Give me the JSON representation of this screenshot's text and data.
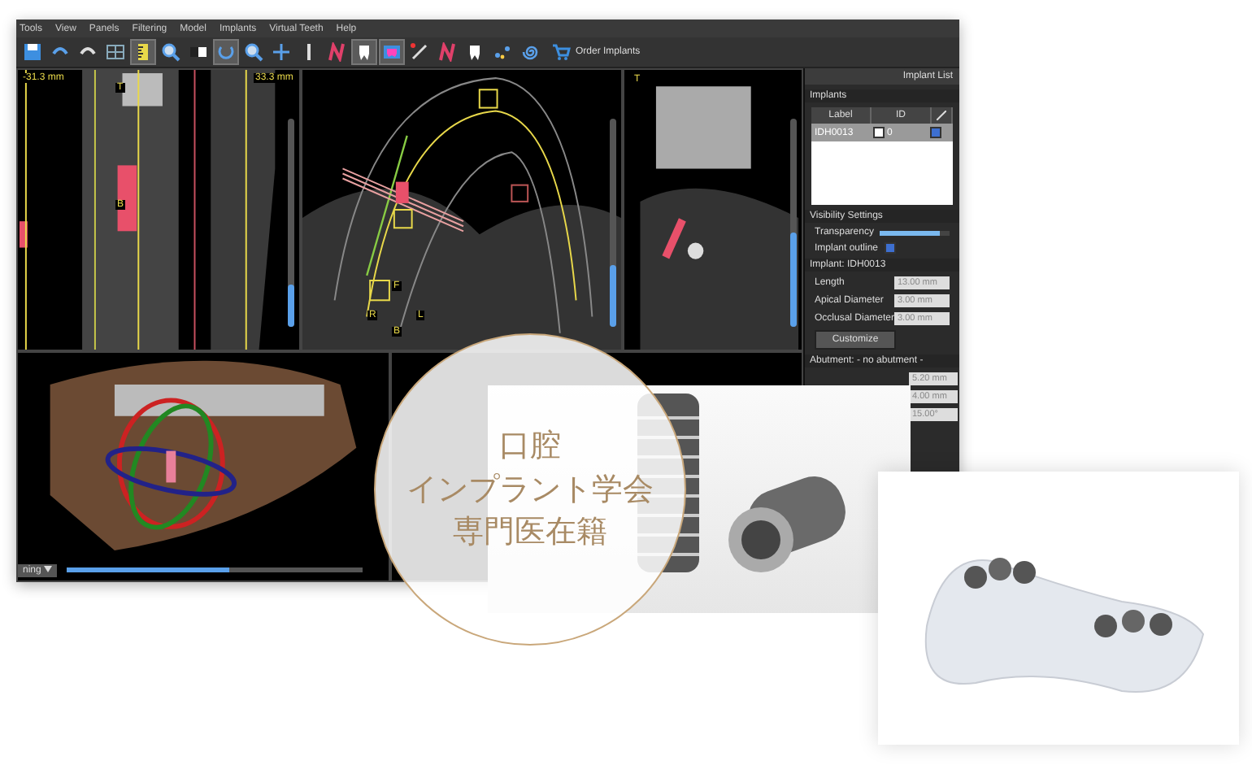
{
  "menu": [
    "Tools",
    "View",
    "Panels",
    "Filtering",
    "Model",
    "Implants",
    "Virtual Teeth",
    "Help"
  ],
  "toolbar": [
    {
      "kind": "save",
      "selected": false
    },
    {
      "kind": "undo",
      "selected": false
    },
    {
      "kind": "redo",
      "selected": false
    },
    {
      "kind": "layout",
      "selected": false
    },
    {
      "kind": "ruler",
      "selected": true
    },
    {
      "kind": "zoom",
      "selected": false
    },
    {
      "kind": "contrast",
      "selected": false
    },
    {
      "kind": "rotate",
      "selected": true
    },
    {
      "kind": "zoom",
      "selected": false
    },
    {
      "kind": "pan",
      "selected": false
    },
    {
      "kind": "probe",
      "selected": false
    },
    {
      "kind": "curve",
      "selected": false
    },
    {
      "kind": "tooth",
      "selected": true
    },
    {
      "kind": "teeth",
      "selected": true
    },
    {
      "kind": "line",
      "selected": false
    },
    {
      "kind": "curve",
      "selected": false
    },
    {
      "kind": "tooth",
      "selected": false
    },
    {
      "kind": "dots",
      "selected": false
    },
    {
      "kind": "spiral",
      "selected": false
    }
  ],
  "order_button": "Order Implants",
  "views": [
    {
      "kind": "coronal",
      "labels": [
        "-31.3 mm",
        "T",
        "B",
        "33.3 mm"
      ],
      "level": 0.2
    },
    {
      "kind": "axial",
      "labels": [
        "F",
        "R",
        "L",
        "B"
      ],
      "level": 0.3
    },
    {
      "kind": "sagittal",
      "labels": [
        "T"
      ],
      "level": 0.45
    },
    {
      "kind": "render3d",
      "dropdown": "ning",
      "level": 0.55
    }
  ],
  "panel": {
    "title": "Implant List",
    "implants_label": "Implants",
    "columns": [
      "Label",
      "ID"
    ],
    "rows": [
      {
        "label": "IDH0013",
        "id": "0",
        "id_checked": false,
        "visible": true
      }
    ],
    "visibility_label": "Visibility Settings",
    "transparency": {
      "label": "Transparency",
      "level": 0.85
    },
    "outline": {
      "label": "Implant outline",
      "checked": true
    },
    "implant_header": "Implant: IDH0013",
    "fields": [
      {
        "label": "Length",
        "value": "13.00 mm"
      },
      {
        "label": "Apical Diameter",
        "value": "3.00 mm"
      },
      {
        "label": "Occlusal Diameter",
        "value": "3.00 mm"
      }
    ],
    "customize": "Customize",
    "abutment_header": "Abutment: - no abutment -",
    "abutment_fields": [
      "5.20 mm",
      "4.00 mm",
      "15.00°"
    ]
  },
  "badge": {
    "lines": [
      "口腔",
      "インプラント学会",
      "専門医在籍"
    ]
  }
}
